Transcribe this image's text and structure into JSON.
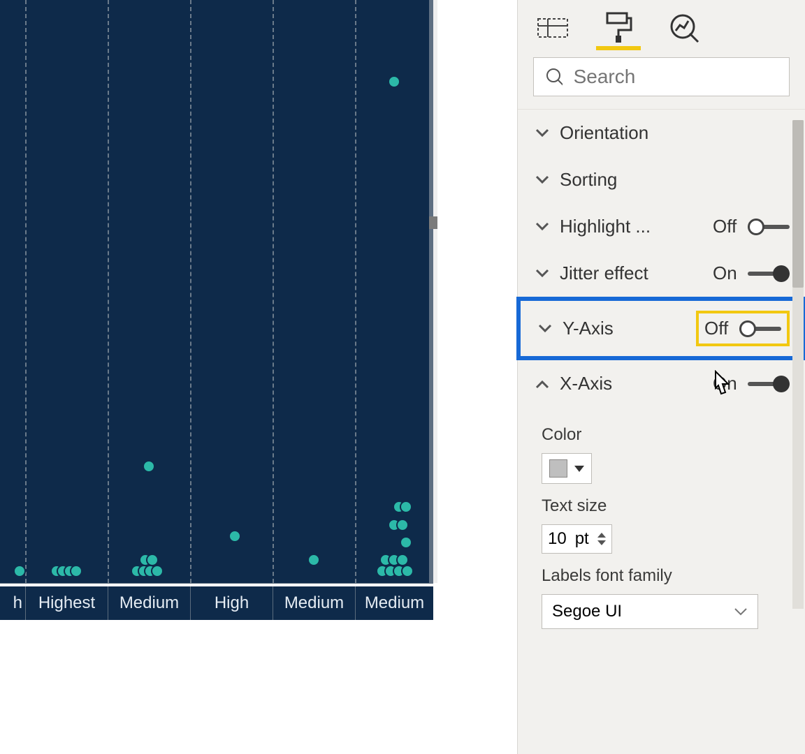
{
  "chart_data": {
    "type": "scatter",
    "categories": [
      "h",
      "Highest",
      "Medium",
      "High",
      "Medium",
      "Medium"
    ],
    "points": [
      {
        "cat": 0,
        "y": 0.02,
        "jx": 0.1
      },
      {
        "cat": 1,
        "y": 0.02,
        "jx": -0.12
      },
      {
        "cat": 1,
        "y": 0.02,
        "jx": -0.04
      },
      {
        "cat": 1,
        "y": 0.02,
        "jx": 0.04
      },
      {
        "cat": 1,
        "y": 0.02,
        "jx": 0.12
      },
      {
        "cat": 2,
        "y": 0.2,
        "jx": 0.0
      },
      {
        "cat": 2,
        "y": 0.02,
        "jx": -0.14
      },
      {
        "cat": 2,
        "y": 0.02,
        "jx": -0.06
      },
      {
        "cat": 2,
        "y": 0.02,
        "jx": 0.02
      },
      {
        "cat": 2,
        "y": 0.02,
        "jx": 0.1
      },
      {
        "cat": 2,
        "y": 0.04,
        "jx": -0.04
      },
      {
        "cat": 2,
        "y": 0.04,
        "jx": 0.04
      },
      {
        "cat": 3,
        "y": 0.08,
        "jx": 0.04
      },
      {
        "cat": 4,
        "y": 0.04,
        "jx": 0.0
      },
      {
        "cat": 5,
        "y": 0.86,
        "jx": 0.0
      },
      {
        "cat": 5,
        "y": 0.13,
        "jx": 0.06
      },
      {
        "cat": 5,
        "y": 0.13,
        "jx": 0.14
      },
      {
        "cat": 5,
        "y": 0.1,
        "jx": 0.0
      },
      {
        "cat": 5,
        "y": 0.1,
        "jx": 0.1
      },
      {
        "cat": 5,
        "y": 0.07,
        "jx": 0.14
      },
      {
        "cat": 5,
        "y": 0.04,
        "jx": -0.1
      },
      {
        "cat": 5,
        "y": 0.04,
        "jx": 0.0
      },
      {
        "cat": 5,
        "y": 0.04,
        "jx": 0.1
      },
      {
        "cat": 5,
        "y": 0.02,
        "jx": -0.14
      },
      {
        "cat": 5,
        "y": 0.02,
        "jx": -0.04
      },
      {
        "cat": 5,
        "y": 0.02,
        "jx": 0.06
      },
      {
        "cat": 5,
        "y": 0.02,
        "jx": 0.16
      }
    ],
    "ylim": [
      0,
      1
    ],
    "title": "",
    "xlabel": "",
    "ylabel": ""
  },
  "colors": {
    "plot_bg": "#0e2a4a",
    "dot": "#2cb9a8",
    "accent_yellow": "#f2c811",
    "highlight_blue": "#1769d6"
  },
  "format_pane": {
    "tabs": {
      "fields": "fields-icon",
      "format": "format-icon",
      "analytics": "analytics-icon",
      "active": "format"
    },
    "search_placeholder": "Search",
    "rows": {
      "orientation": {
        "label": "Orientation"
      },
      "sorting": {
        "label": "Sorting"
      },
      "highlight": {
        "label": "Highlight ...",
        "state": "Off"
      },
      "jitter": {
        "label": "Jitter effect",
        "state": "On"
      },
      "yaxis": {
        "label": "Y-Axis",
        "state": "Off"
      },
      "xaxis": {
        "label": "X-Axis",
        "state": "On"
      }
    },
    "xaxis_props": {
      "color_label": "Color",
      "color_value": "#bfbfbf",
      "textsize_label": "Text size",
      "textsize_value": "10",
      "textsize_unit": "pt",
      "font_label": "Labels font family",
      "font_value": "Segoe UI"
    }
  }
}
